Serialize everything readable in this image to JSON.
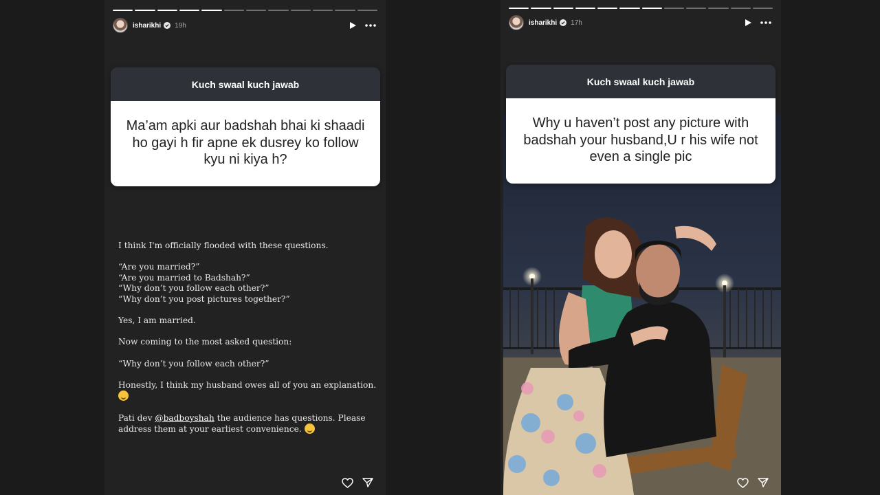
{
  "stories": [
    {
      "username": "isharikhi",
      "time": "19h",
      "progress_completed": 5,
      "progress_total": 12,
      "question_title": "Kuch swaal kuch jawab",
      "question_text": "Ma’am apki aur badshah bhai ki shaadi ho gayi h fir apne ek dusrey ko follow kyu ni kiya h?",
      "caption": {
        "intro": "I think I'm officially flooded with these questions.",
        "questions": [
          "“Are you married?”",
          "“Are you married to Badshah?”",
          "“Why don’t you follow each other?”",
          "“Why don’t you post pictures together?”"
        ],
        "answer": "Yes, I am married.",
        "lead": "Now coming to the most asked question:",
        "most_asked": "“Why don’t you follow each other?”",
        "explanation": "Honestly, I think my husband owes all of you an explanation.",
        "closing_prefix": "Pati dev",
        "mention": "@badboyshah",
        "closing_suffix": "the audience has questions. Please address them at your earliest convenience."
      }
    },
    {
      "username": "isharikhi",
      "time": "17h",
      "progress_completed": 7,
      "progress_total": 12,
      "question_title": "Kuch swaal kuch jawab",
      "question_text": "Why u haven’t post any picture with badshah your husband,U r his wife not even a single pic"
    }
  ],
  "icons": {
    "verified": "verified-badge-icon",
    "play": "play-icon",
    "more": "more-options-icon",
    "like": "heart-icon",
    "share": "send-icon"
  },
  "colors": {
    "background": "#1b1b1b",
    "story_bg": "#222222",
    "card_header": "#2e3238",
    "card_body": "#ffffff"
  }
}
